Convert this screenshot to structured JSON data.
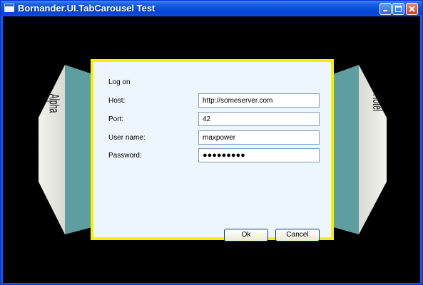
{
  "window": {
    "title": "Bornander.UI.TabCarousel Test"
  },
  "carousel": {
    "left_panel_label": "Alpha",
    "right_panel_label": "Hotel"
  },
  "dialog": {
    "title": "Log on",
    "fields": [
      {
        "label": "Host:",
        "value": "http://someserver.com"
      },
      {
        "label": "Port:",
        "value": "42"
      },
      {
        "label": "User name:",
        "value": "maxpower"
      },
      {
        "label": "Password:",
        "value": "●●●●●●●●●"
      }
    ],
    "ok_label": "Ok",
    "cancel_label": "Cancel"
  },
  "colors": {
    "title_bar": "#0a4ddb",
    "client_background": "#000000",
    "dialog_border": "#f6f000",
    "dialog_background": "#eef6fd",
    "panel_teal": "#5f9ea0"
  }
}
